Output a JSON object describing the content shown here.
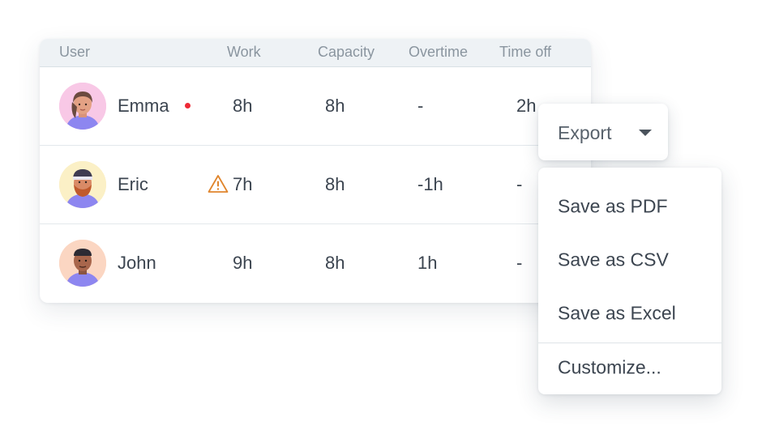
{
  "table": {
    "headers": {
      "user": "User",
      "work": "Work",
      "capacity": "Capacity",
      "overtime": "Overtime",
      "time_off": "Time off"
    },
    "rows": [
      {
        "name": "Emma",
        "work": "8h",
        "capacity": "8h",
        "overtime": "-",
        "time_off": "2h",
        "flag": "red-dot-icon",
        "avatar_bg": "#f8c8e6"
      },
      {
        "name": "Eric",
        "work": "7h",
        "capacity": "8h",
        "overtime": "-1h",
        "time_off": "-",
        "flag": "warning-triangle-icon",
        "avatar_bg": "#fbf0c6"
      },
      {
        "name": "John",
        "work": "9h",
        "capacity": "8h",
        "overtime": "1h",
        "time_off": "-",
        "flag": null,
        "avatar_bg": "#fbd6c2"
      }
    ]
  },
  "export": {
    "label": "Export",
    "icon": "caret-down-icon"
  },
  "menu": {
    "items": [
      "Save as PDF",
      "Save as CSV",
      "Save as Excel"
    ],
    "customize": "Customize..."
  },
  "colors": {
    "header_bg": "#eef2f5",
    "text": "#3c4550",
    "muted": "#8a959f",
    "status_dot": "#ee2a36",
    "warning": "#e0852c"
  }
}
